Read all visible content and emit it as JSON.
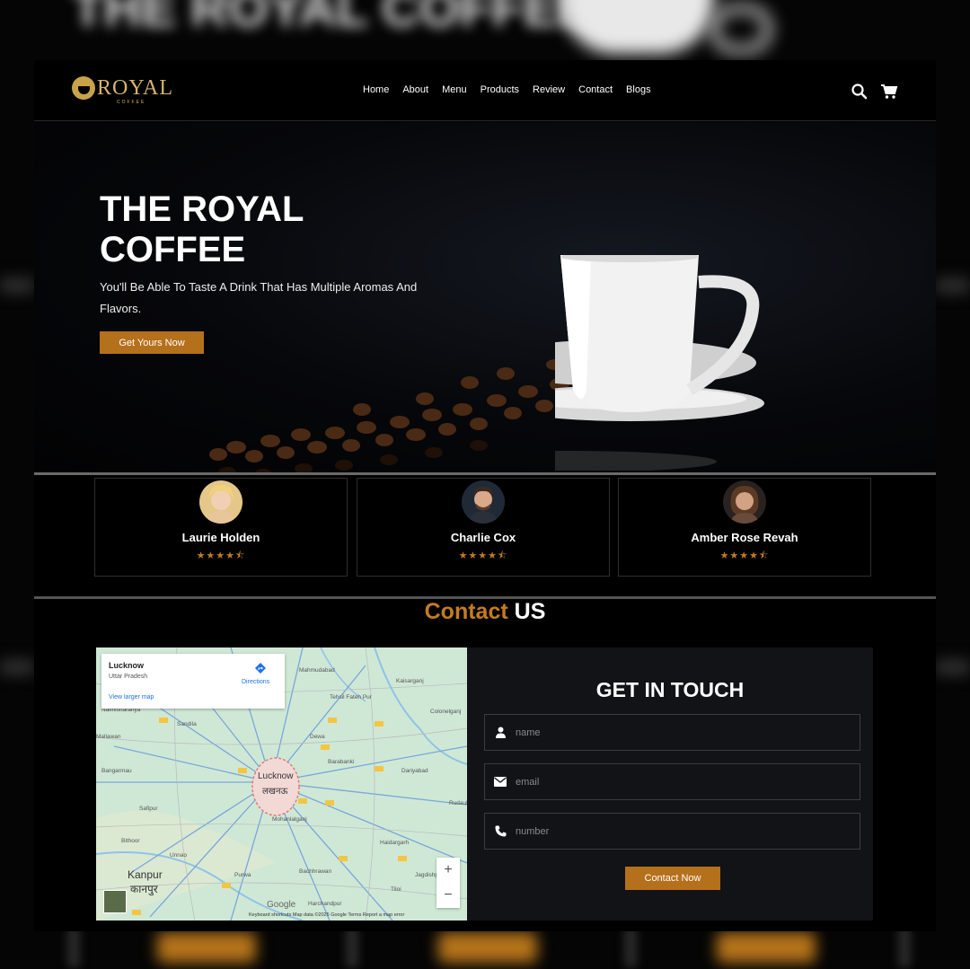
{
  "backdrop": {
    "title": "THE ROYAL COFFEE"
  },
  "header": {
    "logo": {
      "name": "ROYAL",
      "sub": "COFFEE"
    },
    "nav": [
      "Home",
      "About",
      "Menu",
      "Products",
      "Review",
      "Contact",
      "Blogs"
    ],
    "icons": [
      "search-icon",
      "cart-icon"
    ]
  },
  "hero": {
    "title": "THE ROYAL COFFEE",
    "subtitle": "You'll Be Able To Taste A Drink That Has Multiple Aromas And Flavors.",
    "cta": "Get Yours Now"
  },
  "reviews": [
    {
      "name": "Laurie Holden",
      "stars": "★★★★⯪"
    },
    {
      "name": "Charlie Cox",
      "stars": "★★★★⯪"
    },
    {
      "name": "Amber Rose Revah",
      "stars": "★★★★⯪"
    }
  ],
  "contact": {
    "title_accent": "Contact",
    "title_rest": "US",
    "form_title": "GET IN TOUCH",
    "fields": [
      {
        "icon": "user-icon",
        "placeholder": "name"
      },
      {
        "icon": "envelope-icon",
        "placeholder": "email"
      },
      {
        "icon": "phone-icon",
        "placeholder": "number"
      }
    ],
    "submit": "Contact Now"
  },
  "map": {
    "place": "Lucknow",
    "region": "Uttar Pradesh",
    "larger_map": "View larger map",
    "directions": "Directions",
    "zoom_in": "+",
    "zoom_out": "−",
    "brand": "Google",
    "footer": "Keyboard shortcuts    Map data ©2025 Google    Terms    Report a map error",
    "cities": {
      "lucknow": "Lucknow",
      "lucknow_hi": "लखनऊ",
      "kanpur": "Kanpur",
      "kanpur_hi": "कानपुर"
    },
    "towns": {
      "mahmudabad": "Mahmudabad",
      "kaisarganj": "Kaisarganj",
      "tehsil": "Tehsil Fateh Pur",
      "colonelganj": "Colonelganj",
      "sandila": "Sandila",
      "mallawan": "Mallawan",
      "bangarmau": "Bangarmau",
      "dewa": "Dewa",
      "barabanki": "Barabanki",
      "dariyabad": "Dariyabad",
      "rudauli": "Rudaul",
      "safipur": "Safipur",
      "bithoor": "Bithoor",
      "unnao": "Unnao",
      "purwa": "Purwa",
      "mohanlalganj": "Mohanlalganj",
      "haidargarh": "Haidargarh",
      "bachhrawan": "Bachhrawan",
      "jagdishpur": "Jagdishpur",
      "tiloi": "Tiloi",
      "harchandpur": "Harchandpur",
      "naimisharanya": "Naimisharanya"
    }
  }
}
